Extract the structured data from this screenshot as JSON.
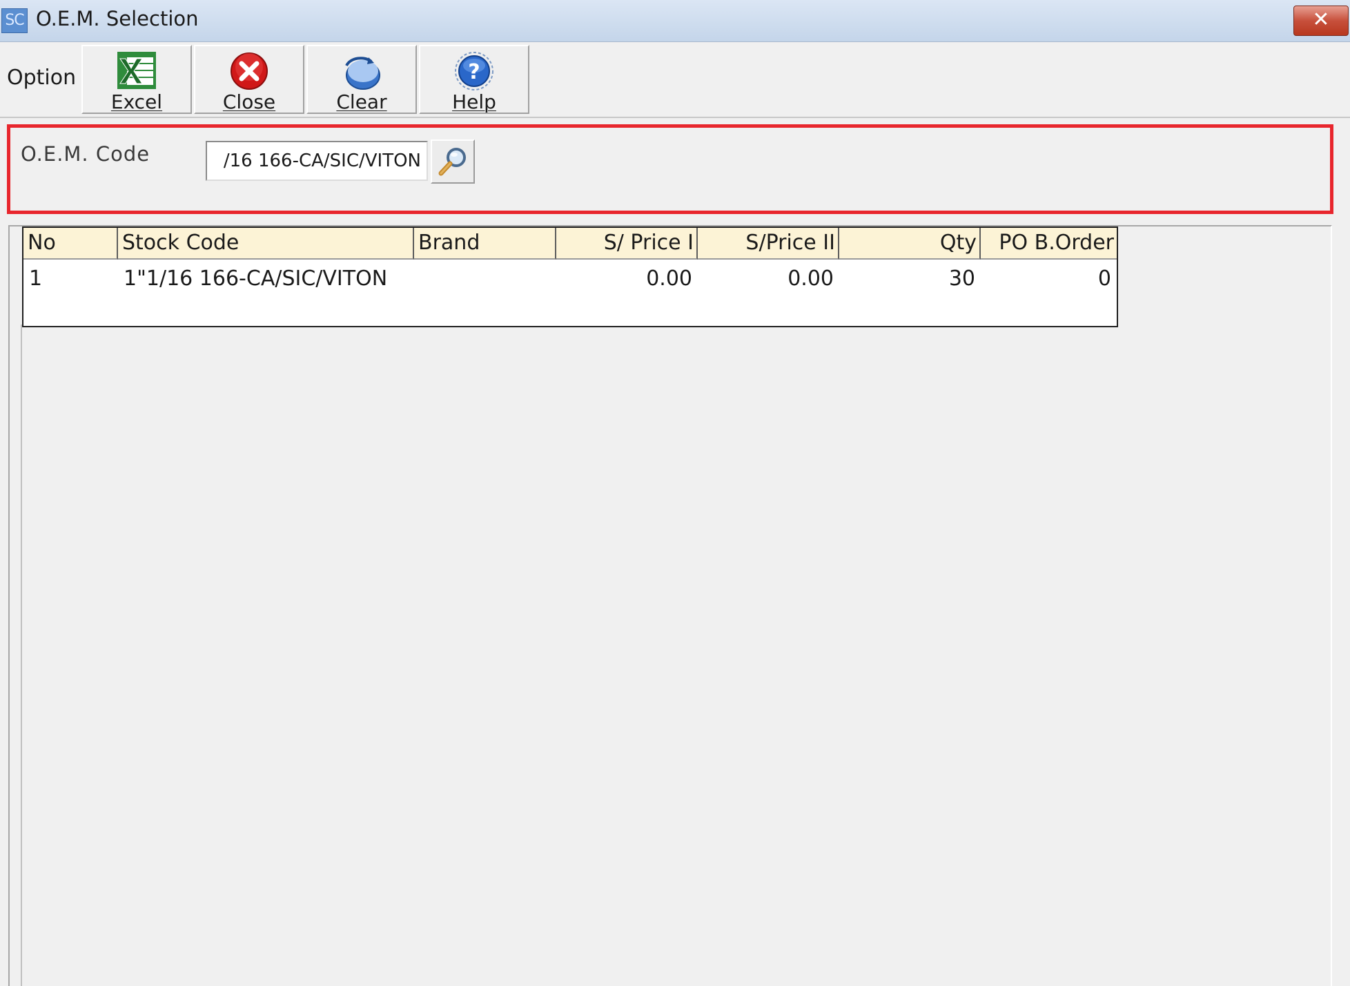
{
  "window": {
    "title": "O.E.M. Selection",
    "app_icon_text": "SC",
    "close_glyph": "✕"
  },
  "toolbar": {
    "option_label": "Option",
    "buttons": [
      {
        "label": "Excel",
        "icon": "excel-icon"
      },
      {
        "label": "Close",
        "icon": "close-circle-icon"
      },
      {
        "label": "Clear",
        "icon": "clear-icon"
      },
      {
        "label": "Help",
        "icon": "help-icon"
      }
    ]
  },
  "filter": {
    "oem_label": "O.E.M. Code",
    "oem_value": "/16 166-CA/SIC/VITON",
    "lookup_icon": "magnifier-icon"
  },
  "grid": {
    "columns": [
      "No",
      "Stock Code",
      "Brand",
      "S/ Price I",
      "S/Price II",
      "Qty",
      "PO B.Order"
    ],
    "rows": [
      {
        "no": "1",
        "stock_code": "1\"1/16 166-CA/SIC/VITON",
        "brand": "",
        "price1": "0.00",
        "price2": "0.00",
        "qty": "30",
        "po_border": "0"
      }
    ]
  },
  "colors": {
    "highlight_border": "#e8262d",
    "header_bg": "#fcf3d6",
    "titlebar": "#c4d5ea"
  }
}
